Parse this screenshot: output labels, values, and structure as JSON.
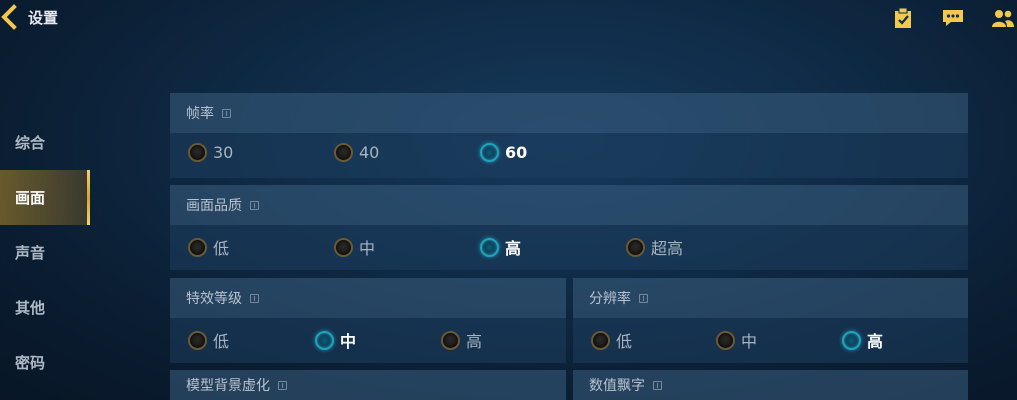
{
  "header": {
    "title": "设置",
    "back_icon": "back-arrow-icon",
    "icons": [
      "clipboard-check-icon",
      "chat-icon",
      "friends-icon"
    ]
  },
  "sidebar": {
    "items": [
      {
        "label": "综合",
        "active": false
      },
      {
        "label": "画面",
        "active": true
      },
      {
        "label": "声音",
        "active": false
      },
      {
        "label": "其他",
        "active": false
      },
      {
        "label": "密码",
        "active": false
      }
    ]
  },
  "settings": {
    "frame_rate": {
      "title": "帧率",
      "options": [
        "30",
        "40",
        "60"
      ],
      "selected": "60"
    },
    "quality": {
      "title": "画面品质",
      "options": [
        "低",
        "中",
        "高",
        "超高"
      ],
      "selected": "高"
    },
    "effects": {
      "title": "特效等级",
      "options": [
        "低",
        "中",
        "高"
      ],
      "selected": "中"
    },
    "resolution": {
      "title": "分辨率",
      "options": [
        "低",
        "中",
        "高"
      ],
      "selected": "高"
    },
    "model_blur": {
      "title": "模型背景虚化"
    },
    "damage_numbers": {
      "title": "数值飘字"
    }
  },
  "colors": {
    "accent_gold": "#f2c94c",
    "selected_cyan": "#1fa3bf",
    "background": "#0f2a45"
  }
}
